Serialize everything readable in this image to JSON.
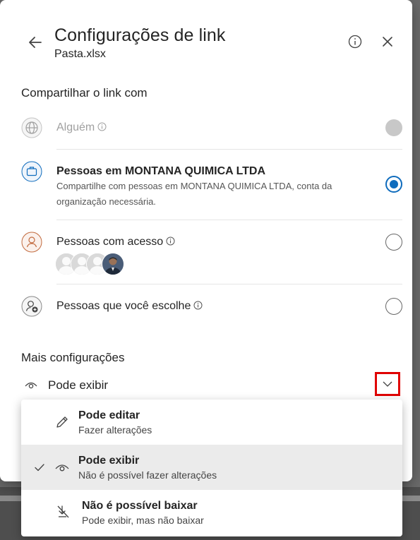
{
  "header": {
    "title": "Configurações de link",
    "filename": "Pasta.xlsx"
  },
  "share_with": {
    "heading": "Compartilhar o link com",
    "options": [
      {
        "label": "Alguém",
        "state": "disabled",
        "icon": "globe-icon"
      },
      {
        "label": "Pessoas em MONTANA QUIMICA LTDA",
        "description": "Compartilhe com pessoas em MONTANA QUIMICA LTDA, conta da organização necessária.",
        "state": "selected",
        "icon": "briefcase-icon"
      },
      {
        "label": "Pessoas com acesso",
        "state": "unselected",
        "icon": "person-sync-icon"
      },
      {
        "label": "Pessoas que você escolhe",
        "state": "unselected",
        "icon": "person-add-icon"
      }
    ]
  },
  "more_settings": {
    "heading": "Mais configurações",
    "current_permission": "Pode exibir"
  },
  "permission_menu": {
    "items": [
      {
        "title": "Pode editar",
        "description": "Fazer alterações",
        "icon": "pencil-icon",
        "selected": false
      },
      {
        "title": "Pode exibir",
        "description": "Não é possível fazer alterações",
        "icon": "eye-icon",
        "selected": true
      },
      {
        "title": "Não é possível baixar",
        "description": "Pode exibir, mas não baixar",
        "icon": "no-download-icon",
        "selected": false
      }
    ]
  },
  "colors": {
    "accent": "#0f6cbd",
    "highlight_box": "#e00000",
    "selected_row": "#ebebeb"
  }
}
